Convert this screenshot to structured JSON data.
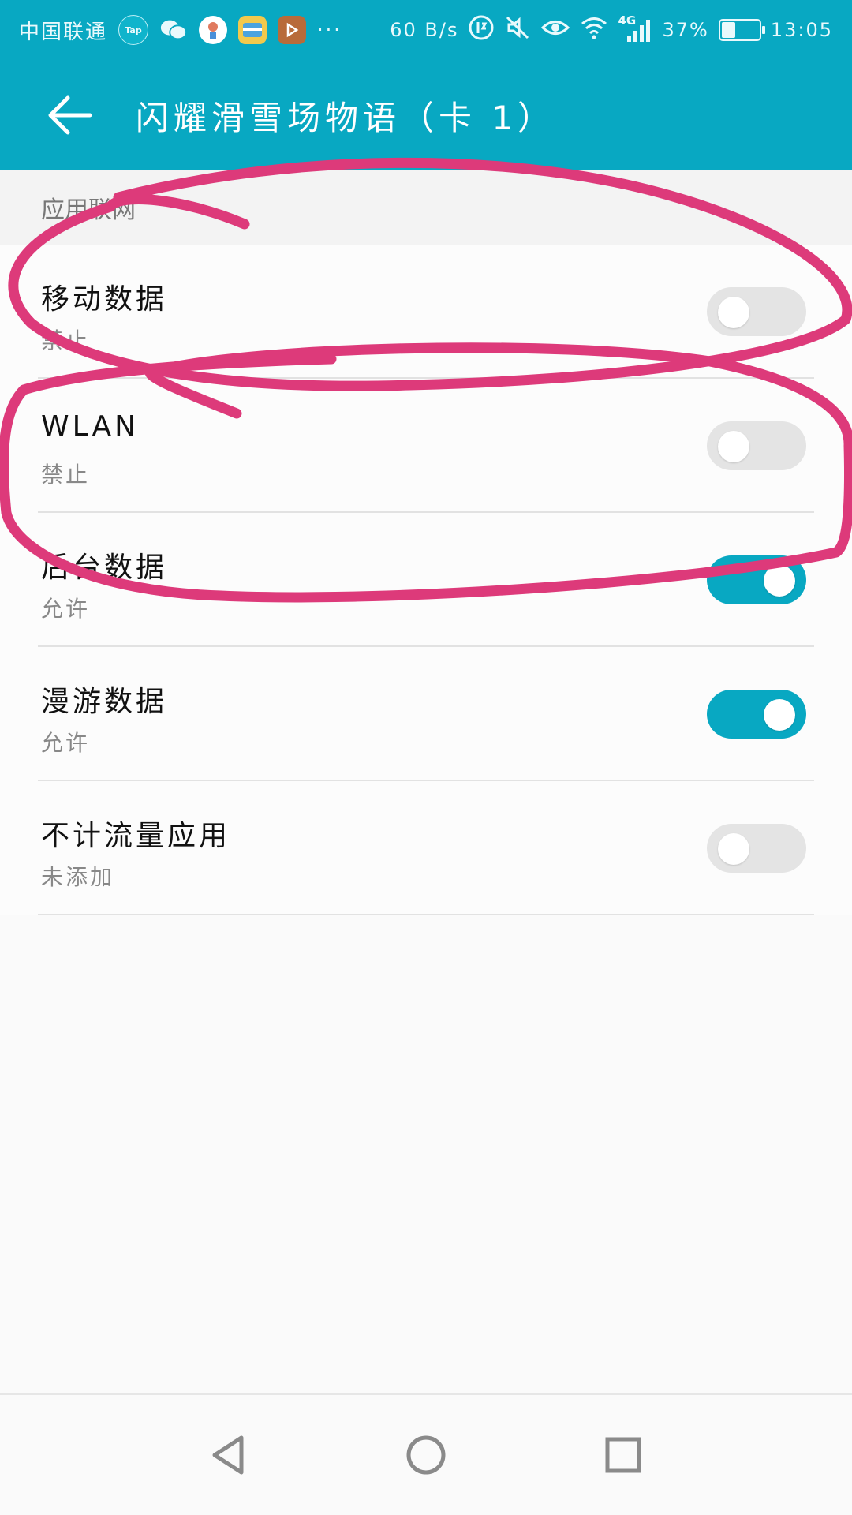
{
  "status_bar": {
    "carrier": "中国联通",
    "tap_icon_label": "Tap",
    "more": "···",
    "net_speed": "60 B/s",
    "network_type": "4G",
    "battery": "37%",
    "battery_level": 0.37,
    "time": "13:05"
  },
  "app_bar": {
    "title": "闪耀滑雪场物语（卡 1）"
  },
  "section": {
    "header": "应用联网"
  },
  "settings": [
    {
      "title": "移动数据",
      "subtitle": "禁止",
      "enabled": false
    },
    {
      "title": "WLAN",
      "subtitle": "禁止",
      "enabled": false
    },
    {
      "title": "后台数据",
      "subtitle": "允许",
      "enabled": true
    },
    {
      "title": "漫游数据",
      "subtitle": "允许",
      "enabled": true
    },
    {
      "title": "不计流量应用",
      "subtitle": "未添加",
      "enabled": false
    }
  ],
  "colors": {
    "accent": "#08a8c2",
    "annotation": "#dd3a7a",
    "toggle_off": "#e4e4e4"
  },
  "icons": {
    "back": "arrow-left-icon",
    "nav_back": "triangle-back-icon",
    "nav_home": "circle-home-icon",
    "nav_recent": "square-recent-icon"
  }
}
